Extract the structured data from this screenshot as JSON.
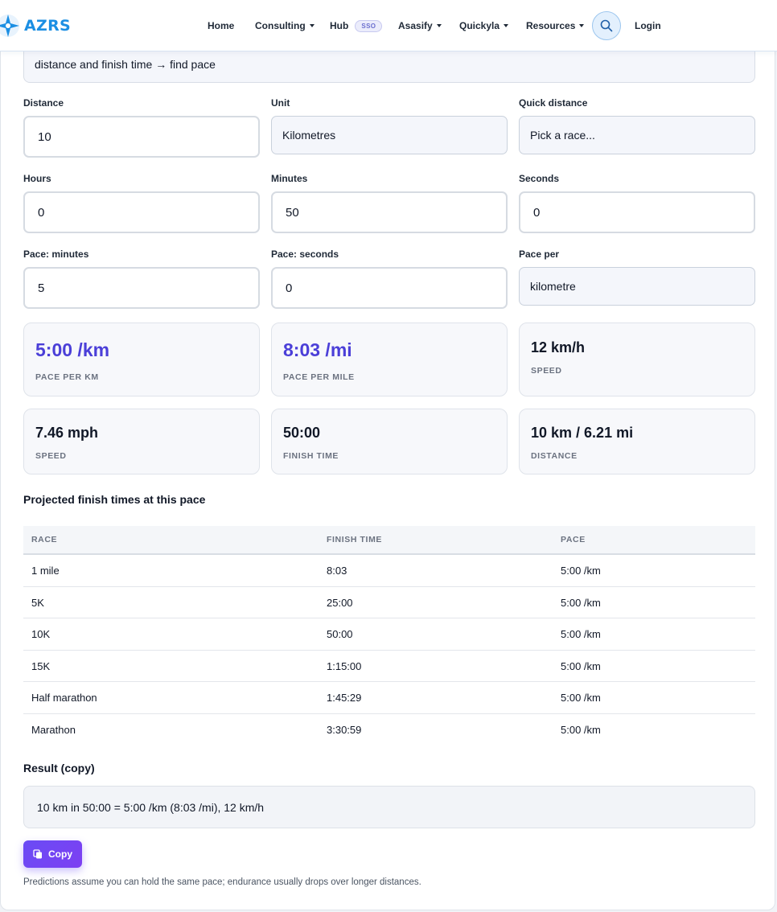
{
  "header": {
    "brand": "AZRS",
    "nav": [
      {
        "label": "Home",
        "dropdown": false
      },
      {
        "label": "Consulting",
        "dropdown": true
      },
      {
        "label": "Hub",
        "dropdown": false,
        "badge": "SSO"
      },
      {
        "label": "Asasify",
        "dropdown": true
      },
      {
        "label": "Quickyla",
        "dropdown": true
      },
      {
        "label": "Resources",
        "dropdown": true
      }
    ],
    "login": "Login"
  },
  "form": {
    "mode": "distance and finish time → find pace",
    "distance": {
      "label": "Distance",
      "value": "10"
    },
    "unit": {
      "label": "Unit",
      "value": "Kilometres"
    },
    "quick": {
      "label": "Quick distance",
      "value": "Pick a race..."
    },
    "hours": {
      "label": "Hours",
      "value": "0"
    },
    "minutes": {
      "label": "Minutes",
      "value": "50"
    },
    "seconds": {
      "label": "Seconds",
      "value": "0"
    },
    "pace_minutes": {
      "label": "Pace: minutes",
      "value": "5"
    },
    "pace_seconds": {
      "label": "Pace: seconds",
      "value": "0"
    },
    "pace_per": {
      "label": "Pace per",
      "value": "kilometre"
    }
  },
  "stats": [
    {
      "value": "5:00 /km",
      "label": "PACE PER KM"
    },
    {
      "value": "8:03 /mi",
      "label": "PACE PER MILE"
    },
    {
      "value": "12 km/h",
      "label": "SPEED"
    },
    {
      "value": "7.46 mph",
      "label": "SPEED"
    },
    {
      "value": "50:00",
      "label": "FINISH TIME"
    },
    {
      "value": "10 km / 6.21 mi",
      "label": "DISTANCE"
    }
  ],
  "projection": {
    "title": "Projected finish times at this pace",
    "columns": [
      "RACE",
      "FINISH TIME",
      "PACE"
    ],
    "rows": [
      [
        "1 mile",
        "8:03",
        "5:00 /km"
      ],
      [
        "5K",
        "25:00",
        "5:00 /km"
      ],
      [
        "10K",
        "50:00",
        "5:00 /km"
      ],
      [
        "15K",
        "1:15:00",
        "5:00 /km"
      ],
      [
        "Half marathon",
        "1:45:29",
        "5:00 /km"
      ],
      [
        "Marathon",
        "3:30:59",
        "5:00 /km"
      ]
    ]
  },
  "result": {
    "title": "Result (copy)",
    "text": "10 km in 50:00 = 5:00 /km (8:03 /mi), 12 km/h",
    "copy_label": "Copy"
  },
  "note": "Predictions assume you can hold the same pace; endurance usually drops over longer distances.",
  "colors": {
    "brand": "#1c8fe3",
    "accent": "#4b3fd8",
    "button": "#6a4cf5"
  }
}
